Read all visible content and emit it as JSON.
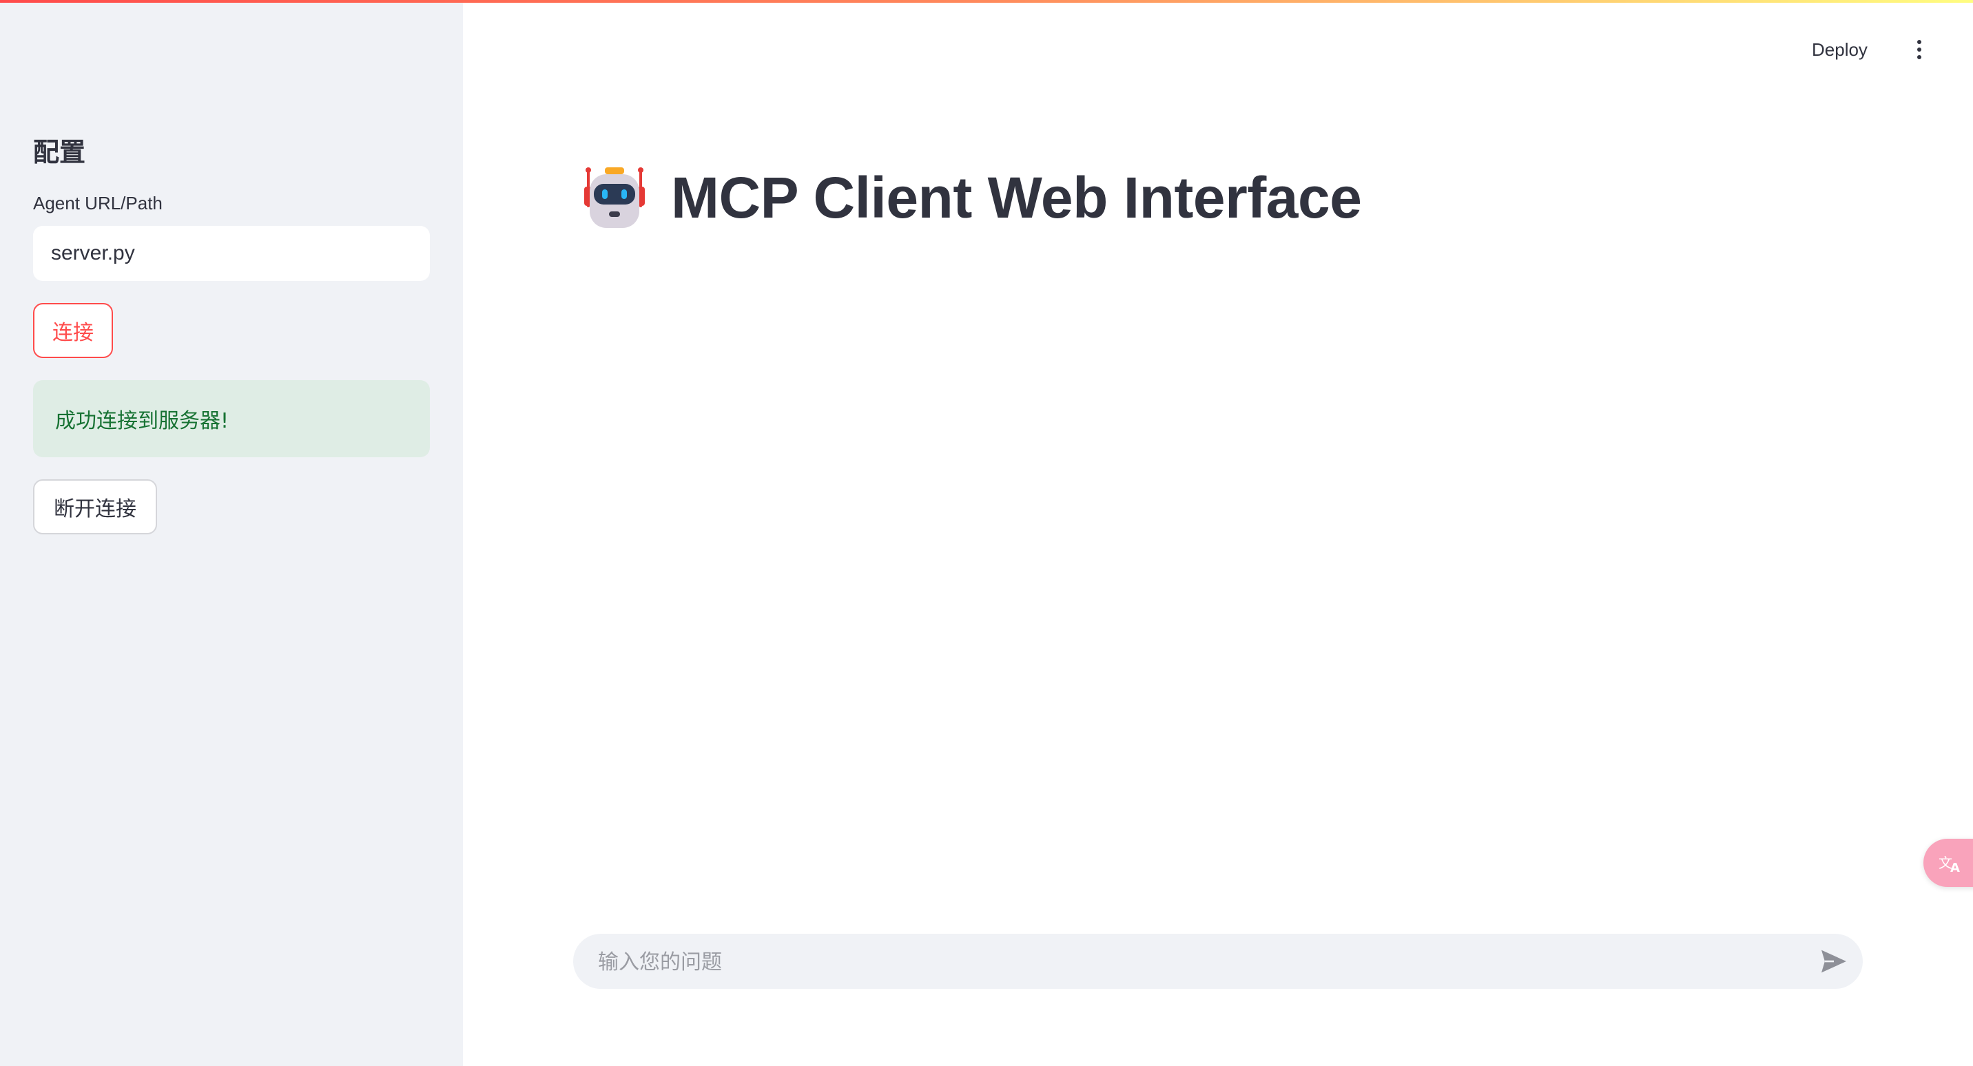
{
  "header": {
    "deploy_label": "Deploy",
    "menu_icon": "more-vertical-icon"
  },
  "sidebar": {
    "title": "配置",
    "agent_field": {
      "label": "Agent URL/Path",
      "value": "server.py"
    },
    "connect_button": "连接",
    "success_message": "成功连接到服务器!",
    "disconnect_button": "断开连接"
  },
  "main": {
    "title_icon": "robot-icon",
    "title": "MCP Client Web Interface"
  },
  "chat": {
    "placeholder": "输入您的问题",
    "send_icon": "send-icon"
  },
  "translate_widget": {
    "icon": "translate-icon"
  },
  "colors": {
    "primary": "#ff4b4b",
    "sidebar_bg": "#f0f2f6",
    "success_bg": "#dfede5",
    "success_text": "#177233",
    "text": "#31333f"
  }
}
